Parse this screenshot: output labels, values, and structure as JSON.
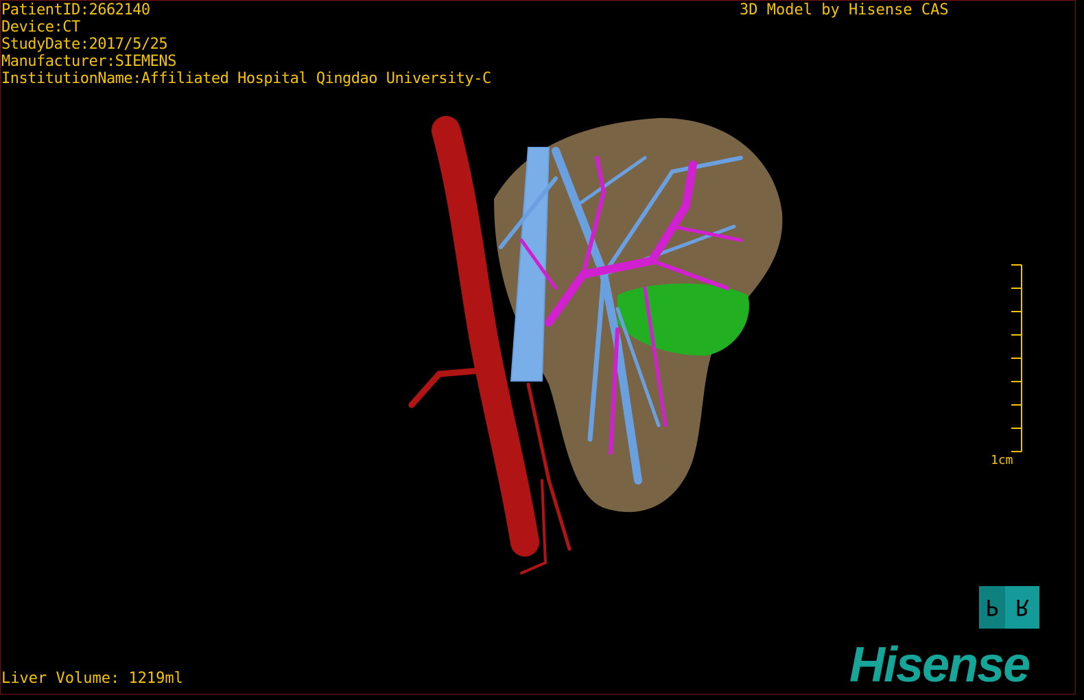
{
  "overlay": {
    "patient_id": "PatientID:2662140",
    "device": "Device:CT",
    "study_date": "StudyDate:2017/5/25",
    "manufacturer": "Manufacturer:SIEMENS",
    "institution": "InstitutionName:Affiliated Hospital Qingdao University-C"
  },
  "title": "3D Model by Hisense CAS",
  "liver_volume": "Liver Volume: 1219ml",
  "scale_bar": {
    "label": "1cm",
    "ticks": 9
  },
  "orientation_cube": {
    "face_left": "P",
    "face_right": "R"
  },
  "logo": "Hisense",
  "colors": {
    "text": "#f5c400",
    "liver": "#7a6446",
    "artery": "#b01414",
    "portal_vein": "#d020d0",
    "hepatic_vein": "#6aa0e0",
    "lesion": "#20b020",
    "logo": "#17a59a"
  }
}
